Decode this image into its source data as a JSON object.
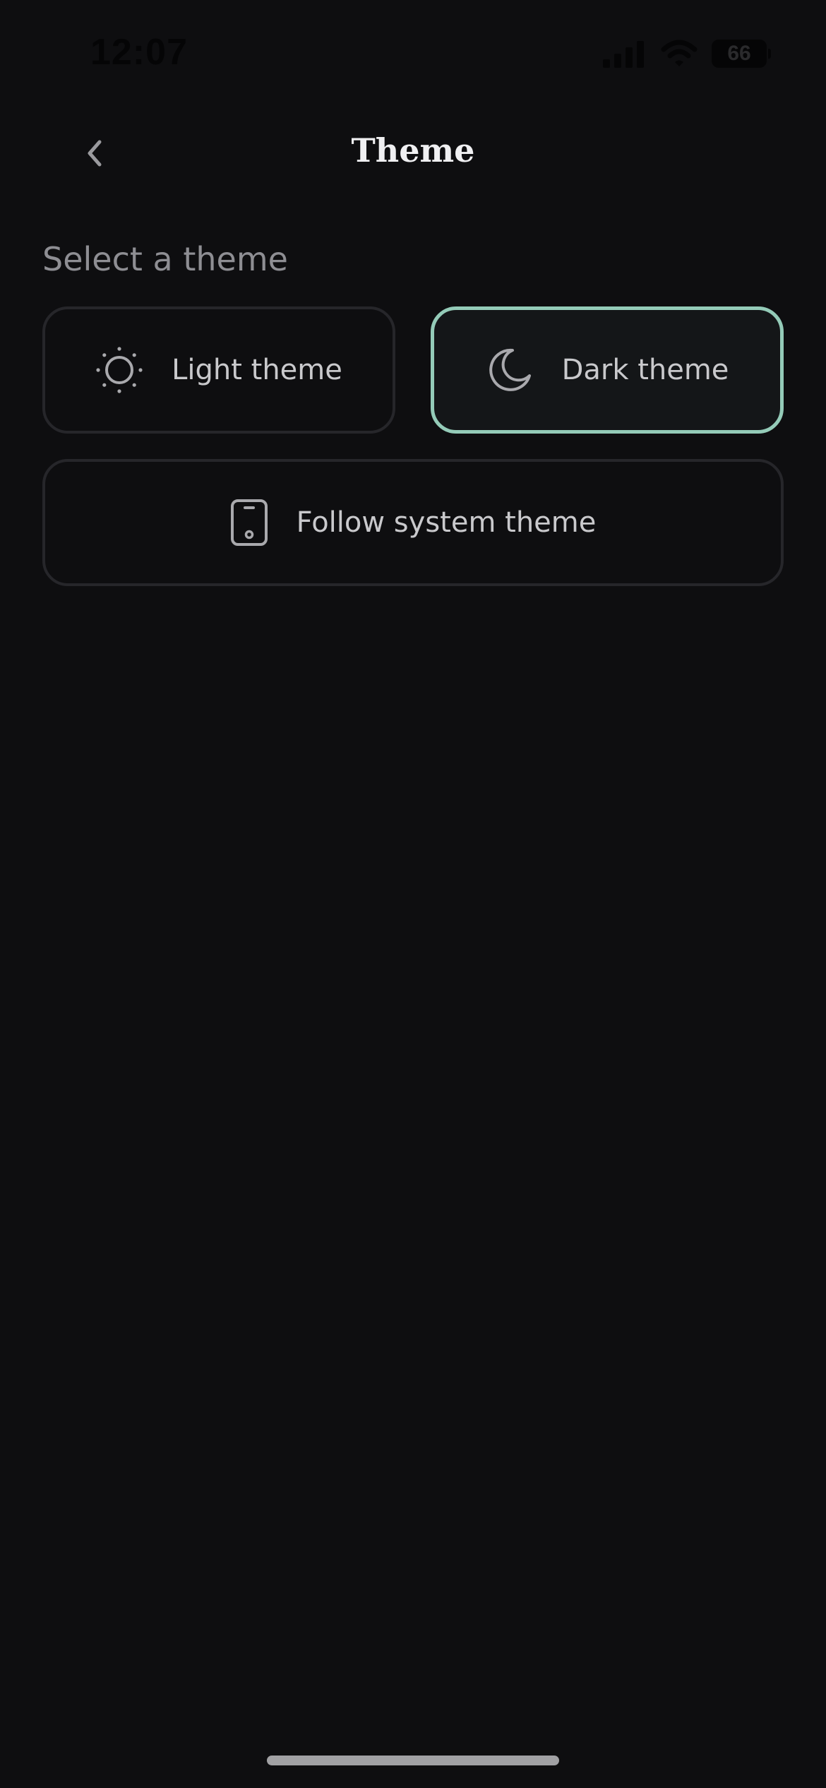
{
  "status_bar": {
    "time": "12:07",
    "battery_level": "66",
    "icons": [
      "signal-icon",
      "wifi-icon",
      "battery-icon"
    ]
  },
  "nav": {
    "back_icon": "chevron-left-icon",
    "title": "Theme"
  },
  "section": {
    "label": "Select a theme"
  },
  "options": [
    {
      "id": "light",
      "icon": "sun-icon",
      "label": "Light theme",
      "selected": false
    },
    {
      "id": "dark",
      "icon": "moon-icon",
      "label": "Dark theme",
      "selected": true
    },
    {
      "id": "system",
      "icon": "phone-icon",
      "label": "Follow system theme",
      "selected": false
    }
  ],
  "colors": {
    "background": "#0e0e10",
    "selected_border": "#94cbb8",
    "card_border": "#26262a",
    "label_muted": "#8e8e93",
    "text": "#c9c9cc"
  }
}
